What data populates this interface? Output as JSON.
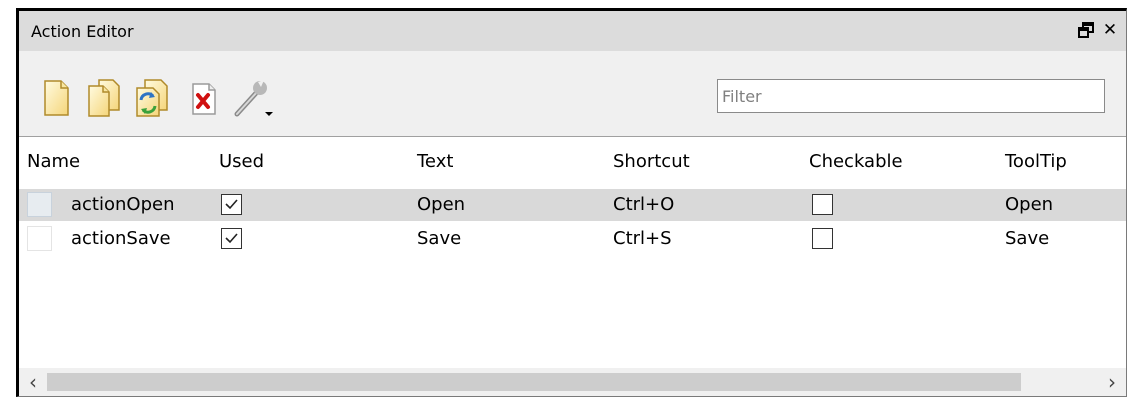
{
  "window": {
    "title": "Action Editor",
    "float_symbol": "🗗",
    "close_symbol": "✕"
  },
  "toolbar": {
    "icons": [
      "new-action-icon",
      "new-folder-icon",
      "copy-action-icon",
      "delete-action-icon",
      "configure-wrench-icon"
    ]
  },
  "filter": {
    "placeholder": "Filter",
    "value": ""
  },
  "table": {
    "columns": [
      "Name",
      "Used",
      "Text",
      "Shortcut",
      "Checkable",
      "ToolTip"
    ],
    "rows": [
      {
        "name": "actionOpen",
        "used": true,
        "text": "Open",
        "shortcut": "Ctrl+O",
        "checkable": false,
        "tooltip": "Open",
        "selected": true
      },
      {
        "name": "actionSave",
        "used": true,
        "text": "Save",
        "shortcut": "Ctrl+S",
        "checkable": false,
        "tooltip": "Save",
        "selected": false
      }
    ]
  },
  "scrollbar": {
    "left_arrow": "‹",
    "right_arrow": "›"
  }
}
